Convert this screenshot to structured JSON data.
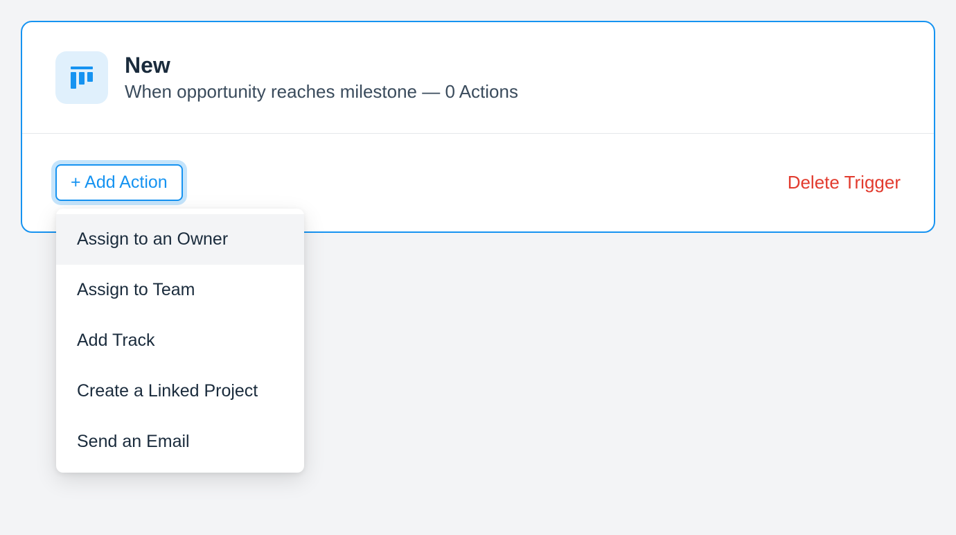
{
  "trigger": {
    "title": "New",
    "subtitle": "When opportunity reaches milestone — 0 Actions",
    "icon": "kanban-icon"
  },
  "buttons": {
    "add_action": "+ Add Action",
    "delete_trigger": "Delete Trigger"
  },
  "dropdown": {
    "items": [
      "Assign to an Owner",
      "Assign to Team",
      "Add Track",
      "Create a Linked Project",
      "Send an Email"
    ]
  }
}
